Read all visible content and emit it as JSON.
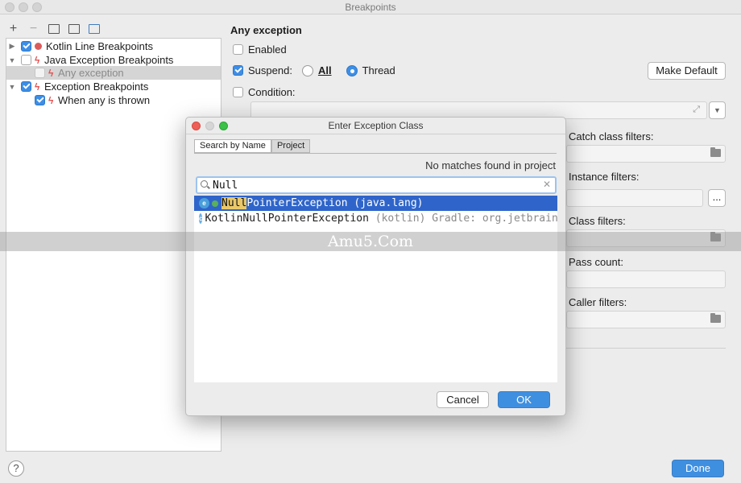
{
  "window": {
    "title": "Breakpoints"
  },
  "toolbar": {
    "add": "+",
    "remove": "−"
  },
  "tree": {
    "items": [
      {
        "label": "Kotlin Line Breakpoints",
        "checked": true
      },
      {
        "label": "Java Exception Breakpoints",
        "checked": false
      },
      {
        "label": "Any exception",
        "checked": false
      },
      {
        "label": "Exception Breakpoints",
        "checked": true
      },
      {
        "label": "When any is thrown",
        "checked": true
      }
    ]
  },
  "details": {
    "title": "Any exception",
    "enabled_label": "Enabled",
    "suspend_label": "Suspend:",
    "all_label": "All",
    "thread_label": "Thread",
    "make_default": "Make Default",
    "condition_label": "Condition:",
    "catch_filters": "Catch class filters:",
    "instance_filters": "Instance filters:",
    "instance_more": "...",
    "class_filters": "Class filters:",
    "pass_count": "Pass count:",
    "caller_filters": "Caller filters:"
  },
  "dialog": {
    "title": "Enter Exception Class",
    "tabs": [
      "Search by Name",
      "Project"
    ],
    "no_matches": "No matches found in project",
    "search_value": "Null",
    "results": [
      {
        "match": "Null",
        "rest": "PointerException",
        "pkg": "(java.lang)",
        "extra": ""
      },
      {
        "match": "",
        "rest": "KotlinNullPointerException",
        "pkg": "(kotlin)",
        "extra": "Gradle: org.jetbrains.ko"
      }
    ],
    "cancel": "Cancel",
    "ok": "OK"
  },
  "watermark": "Amu5.Com",
  "footer": {
    "help": "?",
    "done": "Done"
  }
}
